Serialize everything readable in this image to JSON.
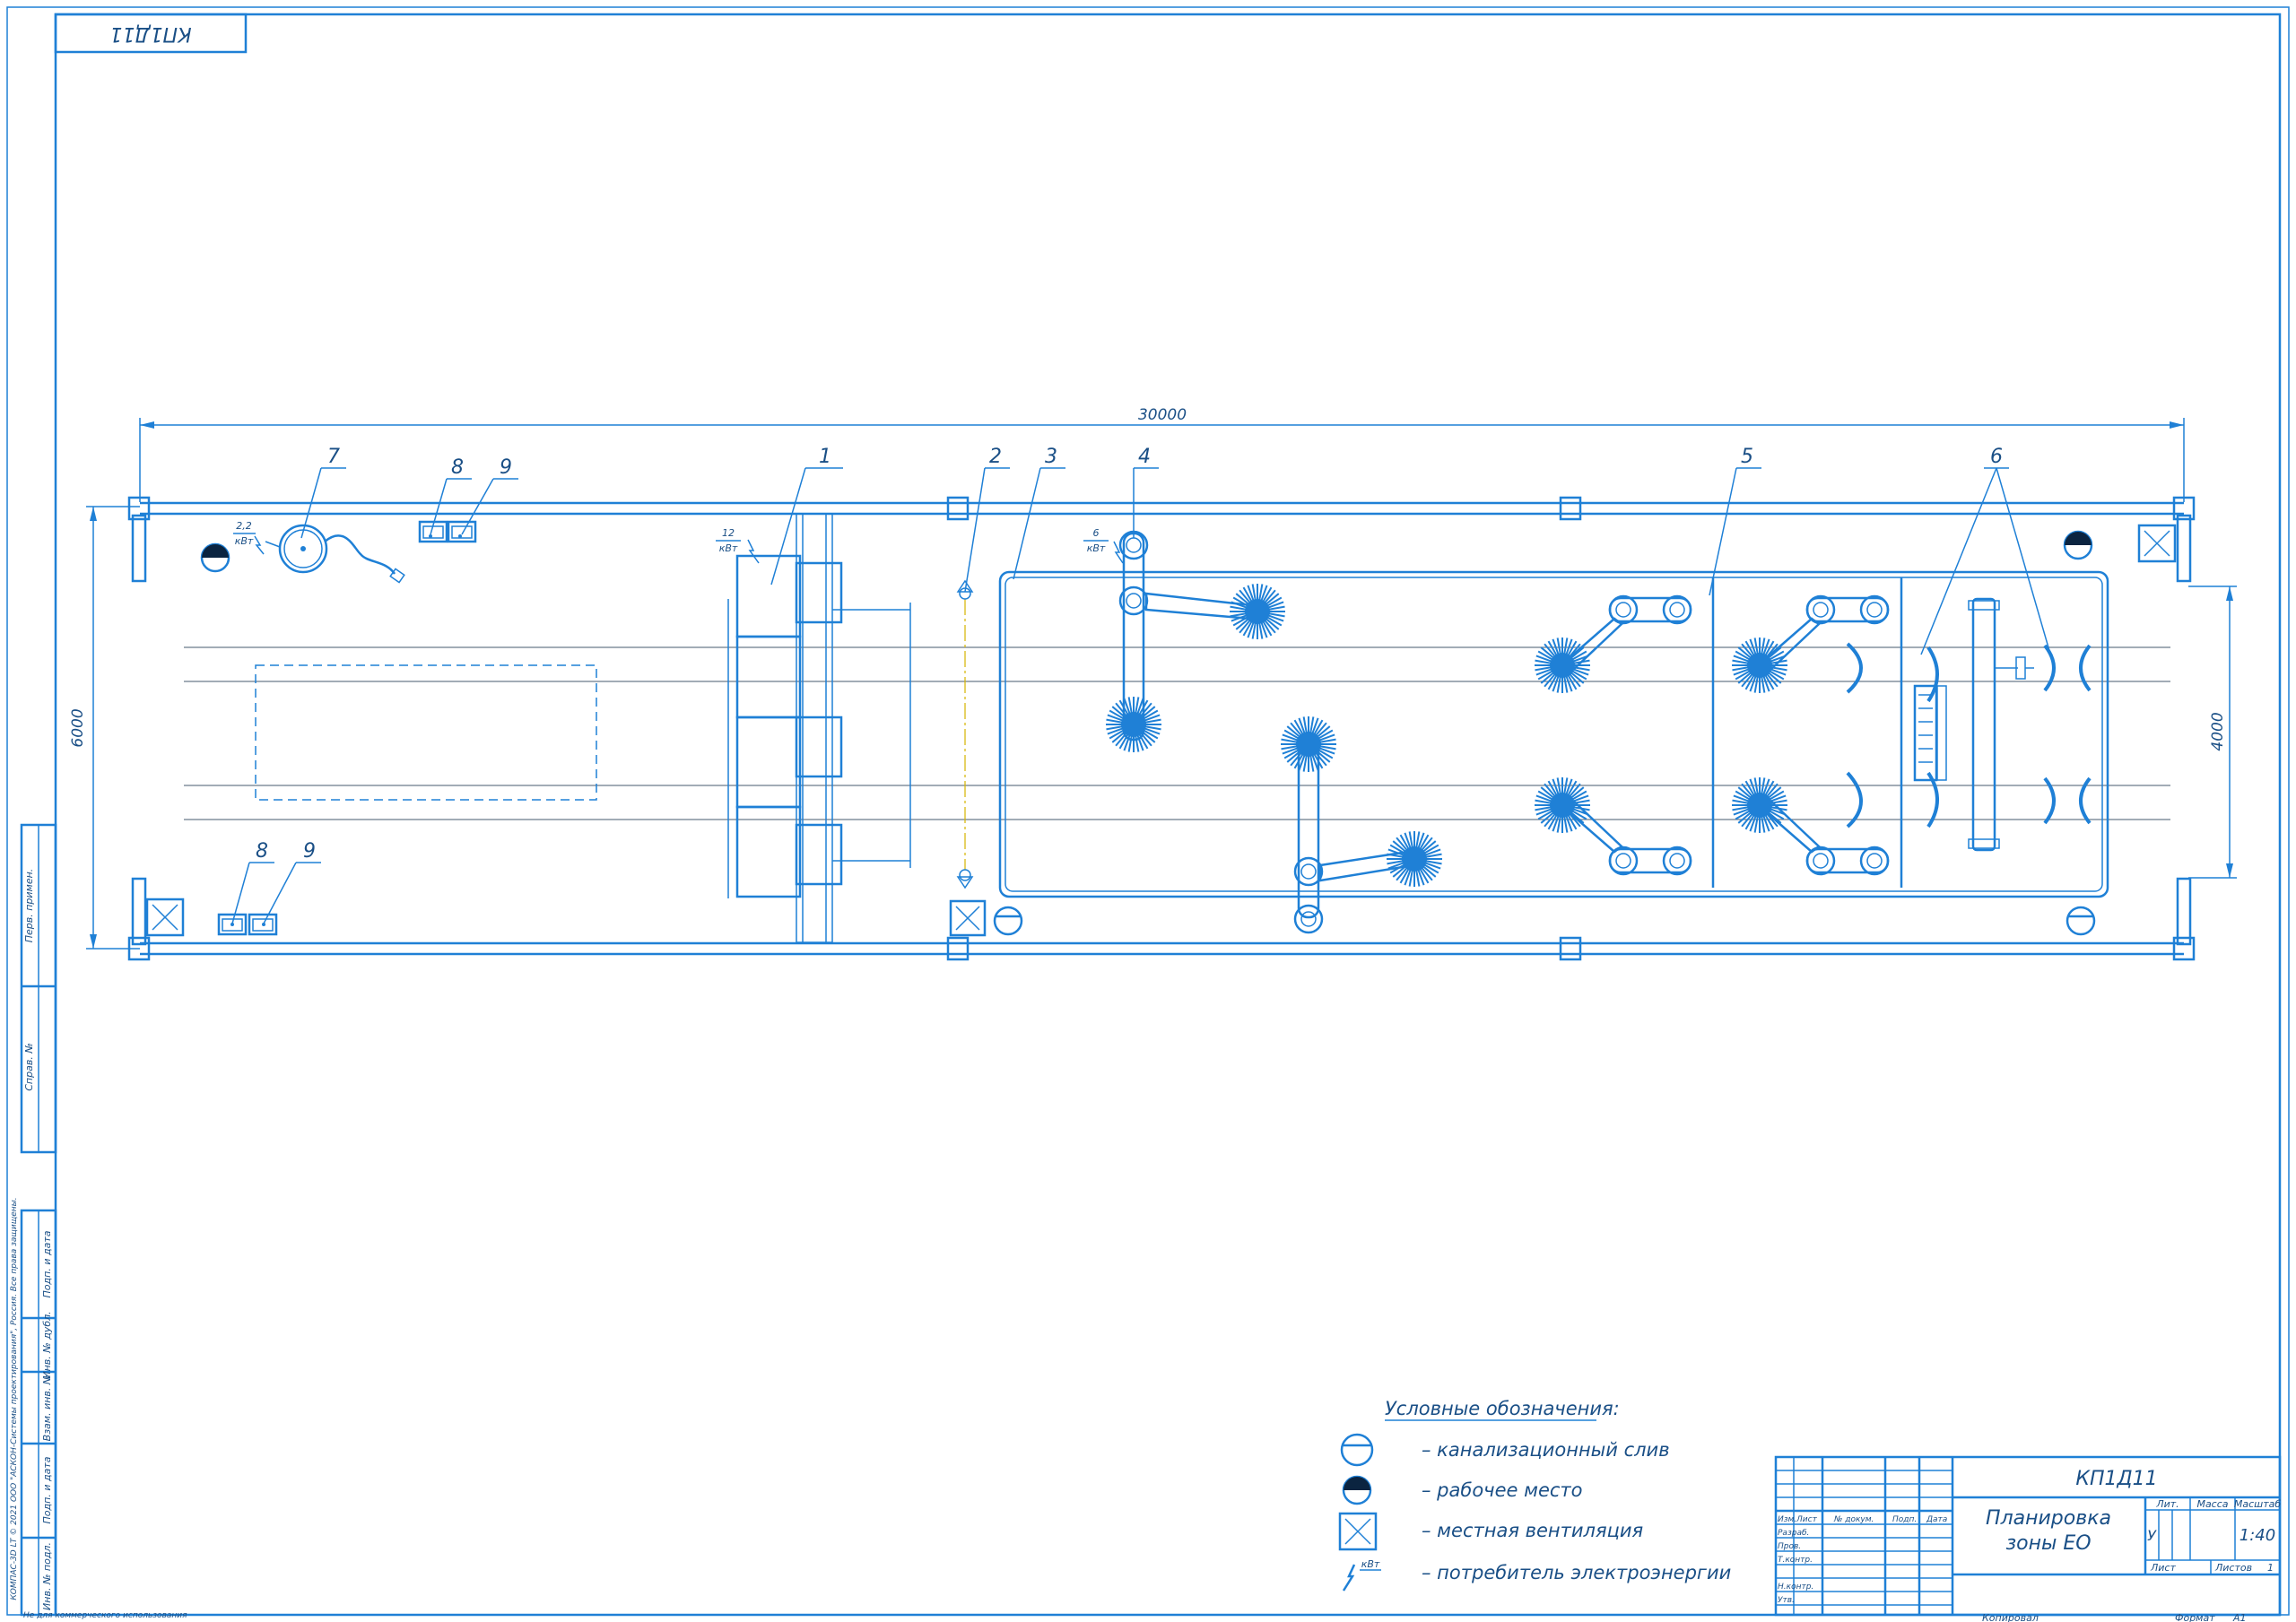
{
  "stamp_top": "КП1Д11",
  "dimensions": {
    "length": "30000",
    "width_left": "6000",
    "width_right": "4000"
  },
  "callouts": [
    "1",
    "2",
    "3",
    "4",
    "5",
    "6",
    "7",
    "8",
    "9",
    "8",
    "9"
  ],
  "power": [
    {
      "value": "2,2",
      "unit": "кВт"
    },
    {
      "value": "12",
      "unit": "кВт"
    },
    {
      "value": "6",
      "unit": "кВт"
    }
  ],
  "legend": {
    "title": "Условные обозначения:",
    "items": [
      {
        "icon": "drain-symbol",
        "text": "– канализационный слив"
      },
      {
        "icon": "workplace-symbol",
        "text": "– рабочее место"
      },
      {
        "icon": "ventilation-symbol",
        "text": "– местная вентиляция"
      },
      {
        "icon": "power-consumer-symbol",
        "unit": "кВт",
        "text": "– потребитель электроэнергии"
      }
    ]
  },
  "title_block": {
    "code": "КП1Д11",
    "title_line1": "Планировка",
    "title_line2": "зоны ЕО",
    "col_headers": [
      "Изм.",
      "Лист",
      "№ докум.",
      "Подп.",
      "Дата"
    ],
    "roles": [
      "Разраб.",
      "Пров.",
      "Т.контр.",
      "",
      "Н.контр.",
      "Утв."
    ],
    "lit_label": "Лит.",
    "mass_label": "Масса",
    "scale_label": "Масштаб",
    "lit_value": "У",
    "scale_value": "1:40",
    "sheet_label": "Лист",
    "sheets_label": "Листов",
    "sheets_value": "1",
    "copied": "Копировал",
    "format_label": "Формат",
    "format_value": "А1"
  },
  "side_strip": {
    "perv_primen": "Перв. примен.",
    "sprav": "Справ. №",
    "podp_data_1": "Подп. и дата",
    "inv_dubl": "Инв. № дубл.",
    "vzam_inv": "Взам. инв. №",
    "podp_data_2": "Подп. и дата",
    "inv_podl": "Инв. № подл."
  },
  "copyright": "КОМПАС-3D LT © 2021 ООО \"АСКОН-Системы проектирования\", Россия. Все права защищены.",
  "footer_note": "Не для коммерческого использования"
}
